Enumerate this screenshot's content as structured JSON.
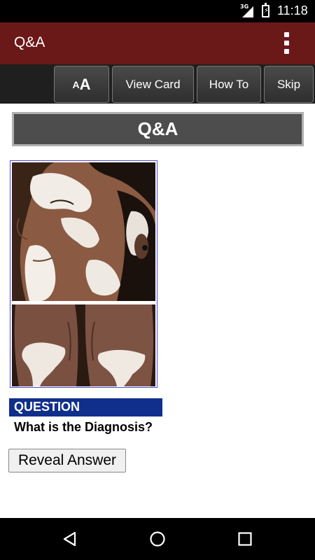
{
  "status_bar": {
    "network": "3G",
    "time": "11:18"
  },
  "app_bar": {
    "title": "Q&A"
  },
  "toolbar": {
    "font_small": "A",
    "font_big": "A",
    "view_card": "View Card",
    "how_to": "How To",
    "skip": "Skip"
  },
  "header": {
    "title": "Q&A"
  },
  "card": {
    "question_label": "QUESTION",
    "question_text": "What is the Diagnosis?",
    "reveal_button": "Reveal Answer"
  },
  "icons": {
    "overflow": "more-vert-icon",
    "back": "back-triangle-icon",
    "home": "home-circle-icon",
    "recents": "recents-square-icon"
  },
  "colors": {
    "app_bar": "#6b1818",
    "question_label": "#102e8c",
    "header_bar": "#4d4d4d"
  }
}
